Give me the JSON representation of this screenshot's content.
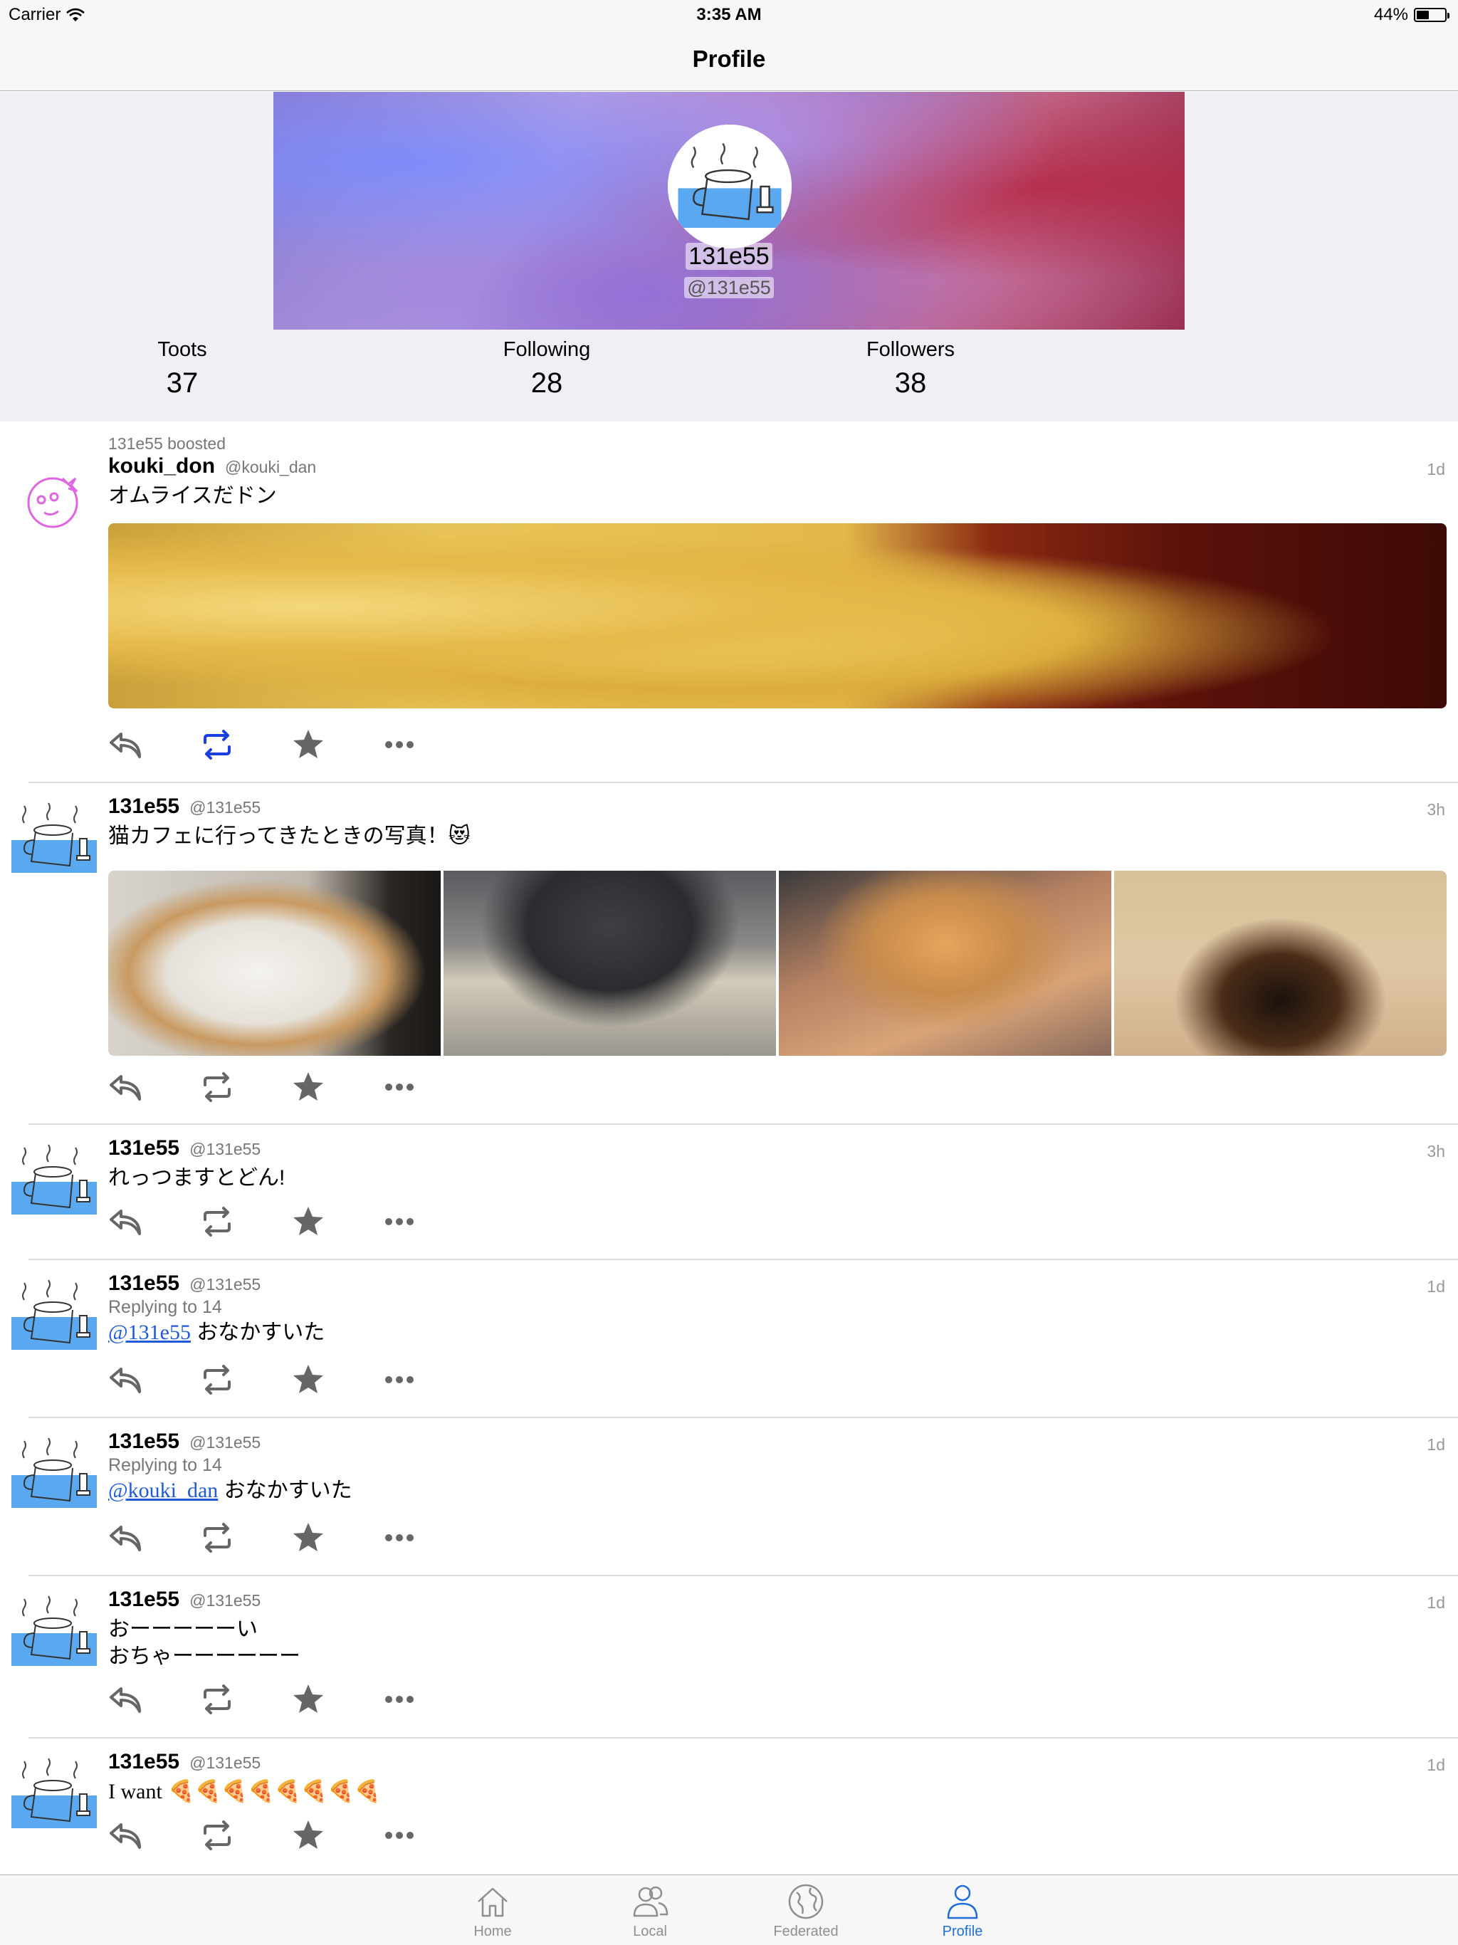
{
  "status_bar": {
    "carrier": "Carrier",
    "time": "3:35 AM",
    "battery": "44%"
  },
  "nav": {
    "title": "Profile"
  },
  "profile": {
    "display_name": "131e55",
    "acct": "@131e55",
    "stats": [
      {
        "label": "Toots",
        "value": "37"
      },
      {
        "label": "Following",
        "value": "28"
      },
      {
        "label": "Followers",
        "value": "38"
      }
    ]
  },
  "posts": [
    {
      "boost": "131e55 boosted",
      "name": "kouki_don",
      "handle": "@kouki_dan",
      "time": "1d",
      "content": "オムライスだドン",
      "boosted": true
    },
    {
      "name": "131e55",
      "handle": "@131e55",
      "time": "3h",
      "content": "猫カフェに行ってきたときの写真！😻"
    },
    {
      "name": "131e55",
      "handle": "@131e55",
      "time": "3h",
      "content": "れっつますとどん!"
    },
    {
      "name": "131e55",
      "handle": "@131e55",
      "time": "1d",
      "reply_to": "Replying to 14",
      "mention": "@131e55",
      "content": " おなかすいた"
    },
    {
      "name": "131e55",
      "handle": "@131e55",
      "time": "1d",
      "reply_to": "Replying to 14",
      "mention": "@kouki_dan",
      "content": " おなかすいた"
    },
    {
      "name": "131e55",
      "handle": "@131e55",
      "time": "1d",
      "content_line1": "おーーーーーい",
      "content_line2": "おちゃーーーーーー"
    },
    {
      "name": "131e55",
      "handle": "@131e55",
      "time": "1d",
      "content_text": "I want",
      "content_emoji": "🍕🍕🍕🍕🍕🍕🍕🍕"
    }
  ],
  "tabs": [
    {
      "label": "Home",
      "icon": "home-icon"
    },
    {
      "label": "Local",
      "icon": "people-icon"
    },
    {
      "label": "Federated",
      "icon": "globe-icon"
    },
    {
      "label": "Profile",
      "icon": "person-icon",
      "active": true
    }
  ],
  "colors": {
    "accent": "#1f6fd6",
    "boost_active": "#1a3fe0",
    "icon_gray": "#666666"
  }
}
